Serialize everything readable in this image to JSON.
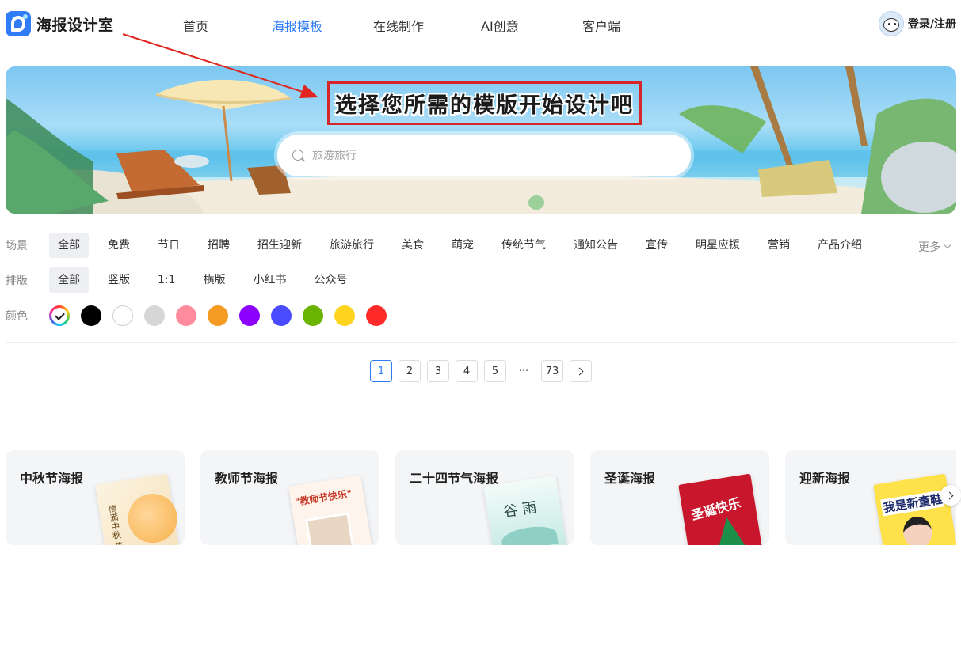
{
  "header": {
    "logo_text": "海报设计室",
    "nav": [
      {
        "label": "首页",
        "active": false
      },
      {
        "label": "海报模板",
        "active": true
      },
      {
        "label": "在线制作",
        "active": false
      },
      {
        "label": "AI创意",
        "active": false
      },
      {
        "label": "客户端",
        "active": false
      }
    ],
    "login_label": "登录/注册"
  },
  "banner": {
    "title": "选择您所需的模版开始设计吧",
    "search_placeholder": "旅游旅行"
  },
  "filters": {
    "scene": {
      "label": "场景",
      "items": [
        "全部",
        "免费",
        "节日",
        "招聘",
        "招生迎新",
        "旅游旅行",
        "美食",
        "萌宠",
        "传统节气",
        "通知公告",
        "宣传",
        "明星应援",
        "营销",
        "产品介绍"
      ],
      "more_label": "更多"
    },
    "layout": {
      "label": "排版",
      "items": [
        "全部",
        "竖版",
        "1:1",
        "横版",
        "小红书",
        "公众号"
      ]
    },
    "color": {
      "label": "颜色",
      "swatches": [
        "all",
        "#000000",
        "#ffffff",
        "#d6d6d6",
        "#ff8c9c",
        "#f59a23",
        "#8b00ff",
        "#4a4aff",
        "#6ab300",
        "#ffd41f",
        "#ff2a2a"
      ]
    }
  },
  "pagination": {
    "pages": [
      "1",
      "2",
      "3",
      "4",
      "5"
    ],
    "ellipsis": "···",
    "last_page": "73",
    "current": "1"
  },
  "categories": [
    {
      "title": "中秋节海报",
      "thumb_text": "情满中秋 花好月圆"
    },
    {
      "title": "教师节海报",
      "thumb_text": "\"教师节快乐\""
    },
    {
      "title": "二十四节气海报",
      "thumb_text": "谷雨"
    },
    {
      "title": "圣诞海报",
      "thumb_text": "圣诞快乐"
    },
    {
      "title": "迎新海报",
      "thumb_text": "我是新童鞋"
    }
  ],
  "colors": {
    "accent": "#2f7cf6",
    "annotation_red": "#d7262a"
  }
}
